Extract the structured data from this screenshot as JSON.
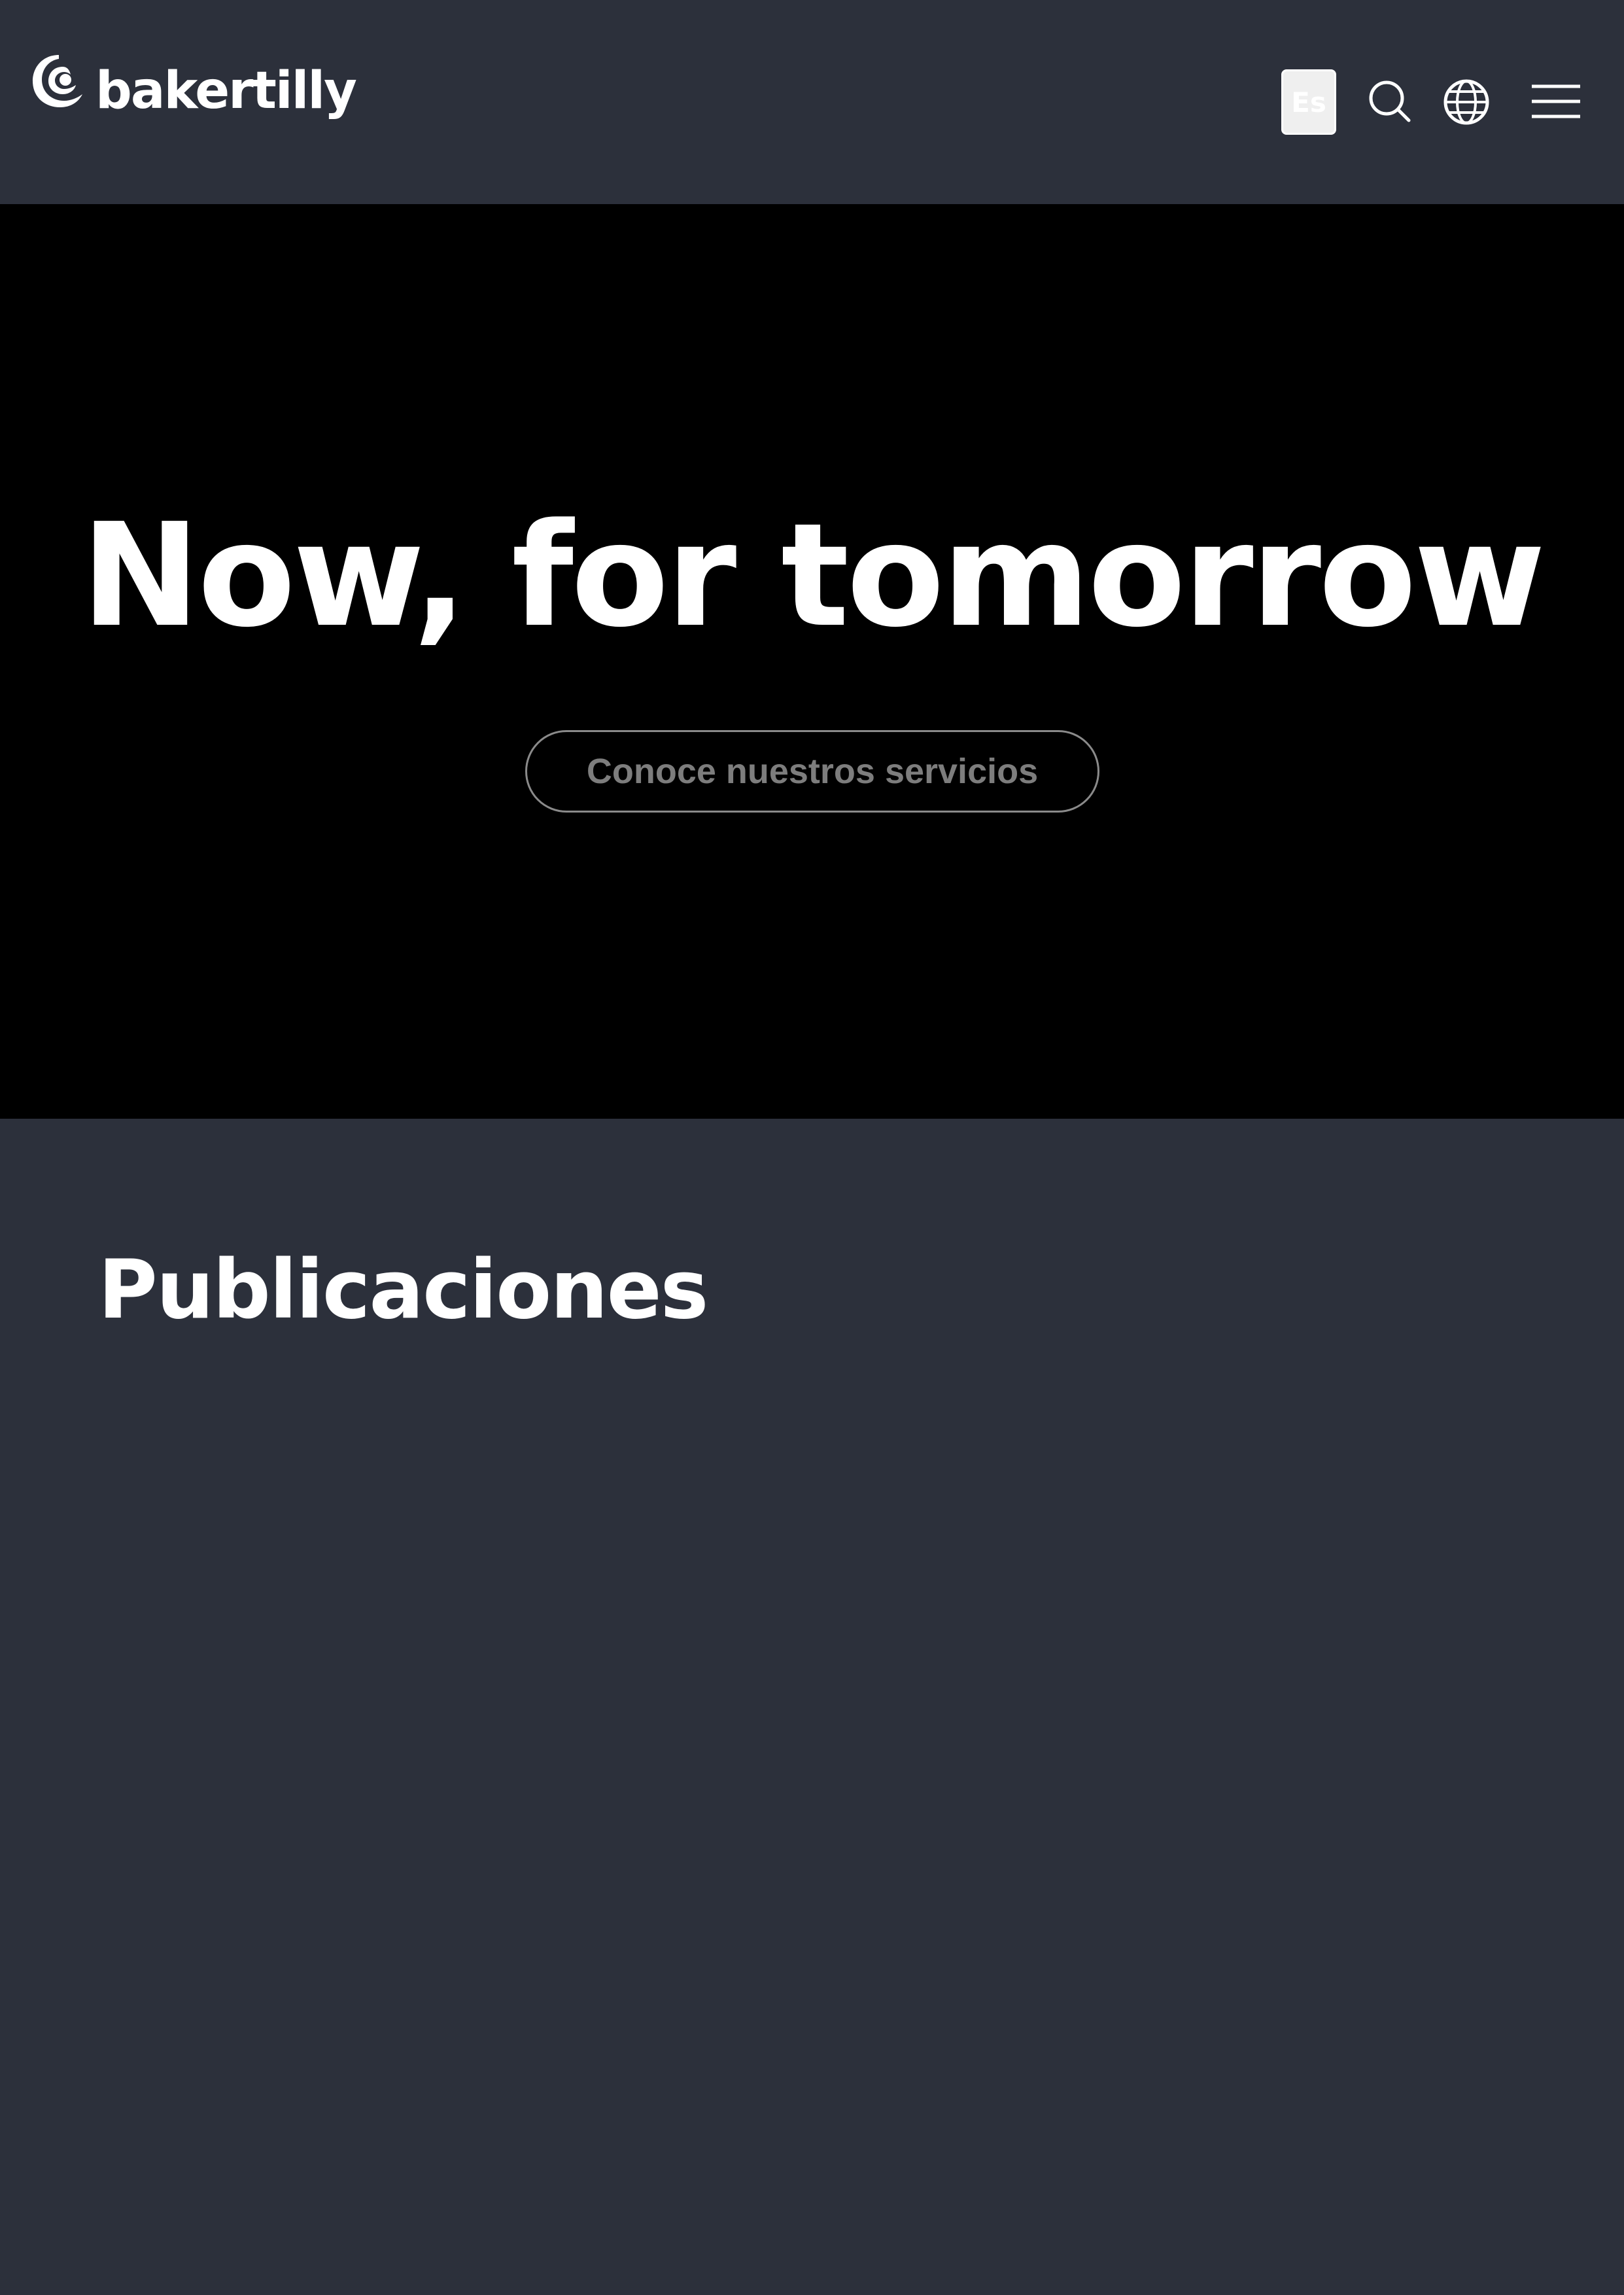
{
  "brand": {
    "name": "bakertilly",
    "colors": {
      "header_bg": "#2c303b",
      "hero_bg": "#000000",
      "text": "#ffffff",
      "cta_text": "#7d7d7d"
    }
  },
  "header": {
    "language_label": "Es",
    "icons": [
      "search-icon",
      "globe-icon",
      "hamburger-menu-icon"
    ]
  },
  "hero": {
    "title": "Now, for tomorrow",
    "cta_label": "Conoce nuestros servicios"
  },
  "publications": {
    "title": "Publicaciones"
  }
}
